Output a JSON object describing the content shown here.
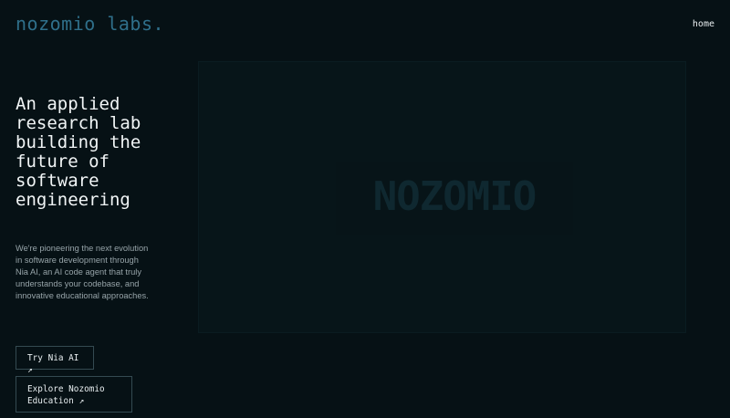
{
  "header": {
    "logo": "nozomio labs.",
    "nav_home": "home"
  },
  "hero": {
    "headline": "An applied research lab building the future of software engineering",
    "description": "We're pioneering the next evolution in software development through Nia AI, an AI code agent that truly understands your codebase, and innovative educational approaches.",
    "background_word": "NOZOMIO"
  },
  "actions": {
    "try_nia": "Try Nia AI ↗",
    "explore_edu_line1": "Explore Nozomio",
    "explore_edu_line2": "Education ↗"
  },
  "colors": {
    "background": "#061115",
    "logo": "#2f6f8a",
    "text": "#f1f5f6",
    "muted": "#97a4a9",
    "border": "#344a51"
  }
}
